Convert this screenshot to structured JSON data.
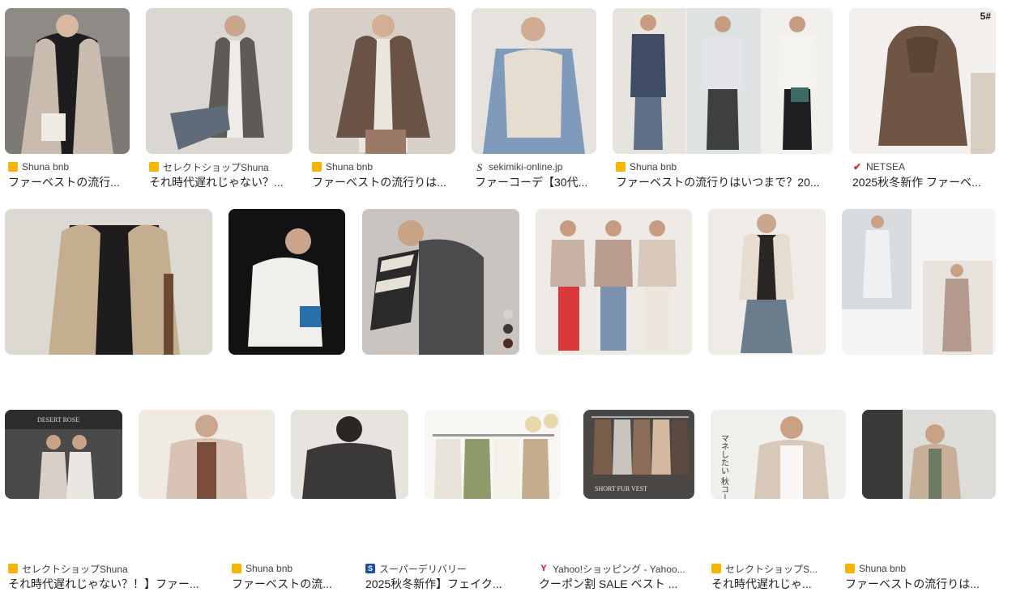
{
  "results": [
    {
      "source": "Shuna bnb",
      "favicon": "shuna-favicon",
      "title": "ファーベストの流行..."
    },
    {
      "source": "セレクトショップShuna",
      "favicon": "shuna-favicon",
      "title": "それ時代遅れじゃない？..."
    },
    {
      "source": "Shuna bnb",
      "favicon": "shuna-favicon",
      "title": "ファーベストの流行りは..."
    },
    {
      "source": "sekimiki-online.jp",
      "favicon": "sekimiki-favicon",
      "title": "ファーコーデ【30代..."
    },
    {
      "source": "Shuna bnb",
      "favicon": "shuna-favicon",
      "title": "ファーベストの流行りはいつまで？20..."
    },
    {
      "source": "NETSEA",
      "favicon": "netsea-favicon",
      "title": "2025秋冬新作 ファーベ...",
      "badge": "5#"
    },
    {
      "source": "セレクトショップShuna",
      "favicon": "shuna-favicon",
      "title": "それ時代遅れじゃない？！】ファー..."
    },
    {
      "source": "Shuna bnb",
      "favicon": "shuna-favicon",
      "title": "ファーベストの流..."
    },
    {
      "source": "スーパーデリバリー",
      "favicon": "super-delivery-favicon",
      "title": "2025秋冬新作】フェイク..."
    },
    {
      "source": "Yahoo!ショッピング - Yahoo...",
      "favicon": "yahoo-favicon",
      "title": "クーポン割 SALE ベスト ..."
    },
    {
      "source": "セレクトショップS...",
      "favicon": "shuna-favicon",
      "title": "それ時代遅れじゃ..."
    },
    {
      "source": "Shuna bnb",
      "favicon": "shuna-favicon",
      "title": "ファーベストの流行りは..."
    },
    {
      "overlay": "DESERT ROSE"
    },
    {},
    {},
    {},
    {
      "overlay": "SHORT FUR VEST"
    },
    {
      "overlay": "マネしたい 秋コーデのア"
    },
    {}
  ],
  "colors": {
    "shuna": "#f5b400",
    "yahoo": "#e60033",
    "netsea": "#d32f2f",
    "super": "#1a4fa0"
  }
}
